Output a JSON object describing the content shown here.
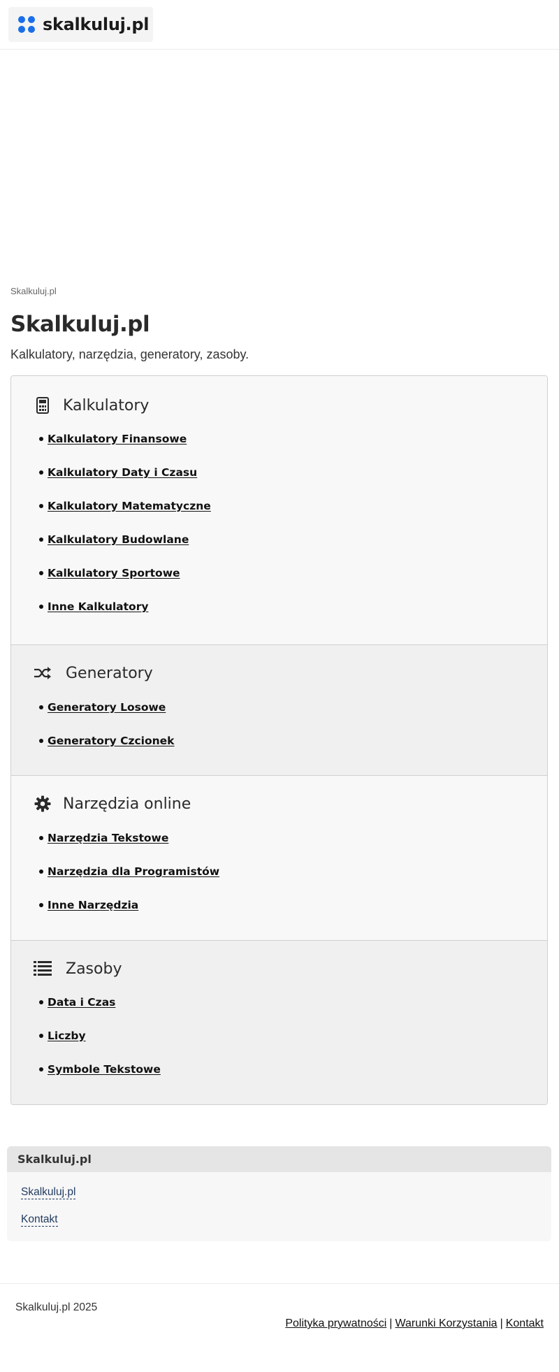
{
  "header": {
    "logo_text": "skalkuluj.pl",
    "logo_color": "#1a6fe8"
  },
  "breadcrumb": "Skalkuluj.pl",
  "page": {
    "title": "Skalkuluj.pl",
    "subtitle": "Kalkulatory, narzędzia, generatory, zasoby."
  },
  "categories": [
    {
      "title": "Kalkulatory",
      "icon": "calculator-icon",
      "items": [
        "Kalkulatory Finansowe",
        "Kalkulatory Daty i Czasu",
        "Kalkulatory Matematyczne",
        "Kalkulatory Budowlane",
        "Kalkulatory Sportowe",
        "Inne Kalkulatory"
      ]
    },
    {
      "title": "Generatory",
      "icon": "shuffle-icon",
      "items": [
        "Generatory Losowe",
        "Generatory Czcionek"
      ]
    },
    {
      "title": "Narzędzia online",
      "icon": "gear-icon",
      "items": [
        "Narzędzia Tekstowe",
        "Narzędzia dla Programistów",
        "Inne Narzędzia"
      ]
    },
    {
      "title": "Zasoby",
      "icon": "list-icon",
      "items": [
        "Data i Czas",
        "Liczby",
        "Symbole Tekstowe"
      ]
    }
  ],
  "footer_box": {
    "title": "Skalkuluj.pl",
    "links": [
      "Skalkuluj.pl",
      "Kontakt"
    ]
  },
  "bottom": {
    "copyright": "Skalkuluj.pl 2025",
    "links": [
      "Polityka prywatności",
      "Warunki Korzystania",
      "Kontakt"
    ],
    "separator": "|"
  }
}
